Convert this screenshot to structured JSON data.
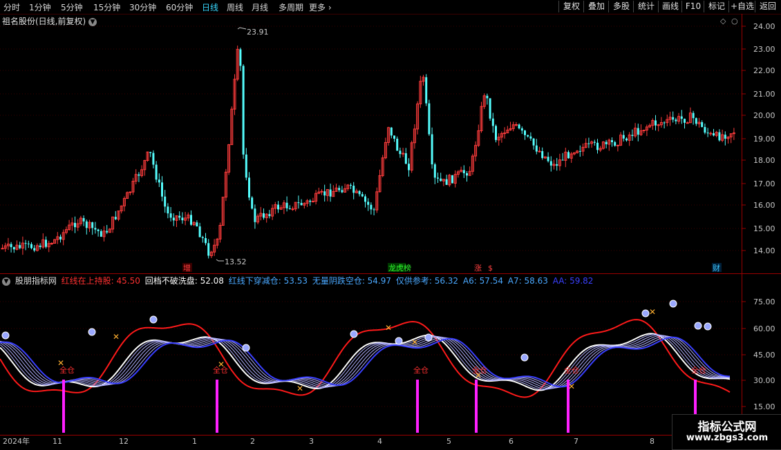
{
  "toolbar": {
    "periods": [
      "分时",
      "1分钟",
      "5分钟",
      "15分钟",
      "30分钟",
      "60分钟",
      "日线",
      "周线",
      "月线",
      "多周期",
      "更多"
    ],
    "active_period": "日线",
    "more_icon": "chevron-right-icon",
    "buttons": [
      "复权",
      "叠加",
      "多股",
      "统计",
      "画线",
      "F10",
      "标记",
      "+自选",
      "返回"
    ]
  },
  "main_chart": {
    "title": "祖名股份(日线,前复权)",
    "title_icon": "chevron-down-icon",
    "y_ticks": [
      "24.00",
      "23.00",
      "22.00",
      "21.00",
      "20.00",
      "19.00",
      "18.00",
      "17.00",
      "16.00",
      "15.00",
      "14.00"
    ],
    "high_label": "23.91",
    "low_label": "13.52",
    "markers": [
      "增",
      "龙虎榜",
      "涨",
      "$",
      "财"
    ],
    "up_color": "#ff3c3c",
    "down_color": "#54fcfc"
  },
  "indicator": {
    "name": "股朋指标网",
    "legend": [
      {
        "label": "红线在上持股: 45.50",
        "color": "#ff3030"
      },
      {
        "label": "回档不破洗盘: 52.08",
        "color": "#ffffff"
      },
      {
        "label": "红线下穿减仓: 53.53",
        "color": "#4aa8ff"
      },
      {
        "label": "无量阴跌空仓: 54.97",
        "color": "#4aa8ff"
      },
      {
        "label": "仅供参考: 56.32",
        "color": "#4aa8ff"
      },
      {
        "label": "A6: 57.54",
        "color": "#4aa8ff"
      },
      {
        "label": "A7: 58.63",
        "color": "#4aa8ff"
      },
      {
        "label": "AA: 59.82",
        "color": "#3a40ff"
      }
    ],
    "y_ticks": [
      "75.00",
      "60.00",
      "45.00",
      "30.00",
      "15.00"
    ],
    "signal_label": "全仓",
    "bar_color": "#ff20ff"
  },
  "x_axis": {
    "labels": [
      "2024年",
      "11",
      "12",
      "1",
      "2",
      "3",
      "4",
      "5",
      "6",
      "7",
      "8"
    ]
  },
  "watermark": {
    "line1": "指标公式网",
    "line2": "www.zbgs3.com"
  }
}
